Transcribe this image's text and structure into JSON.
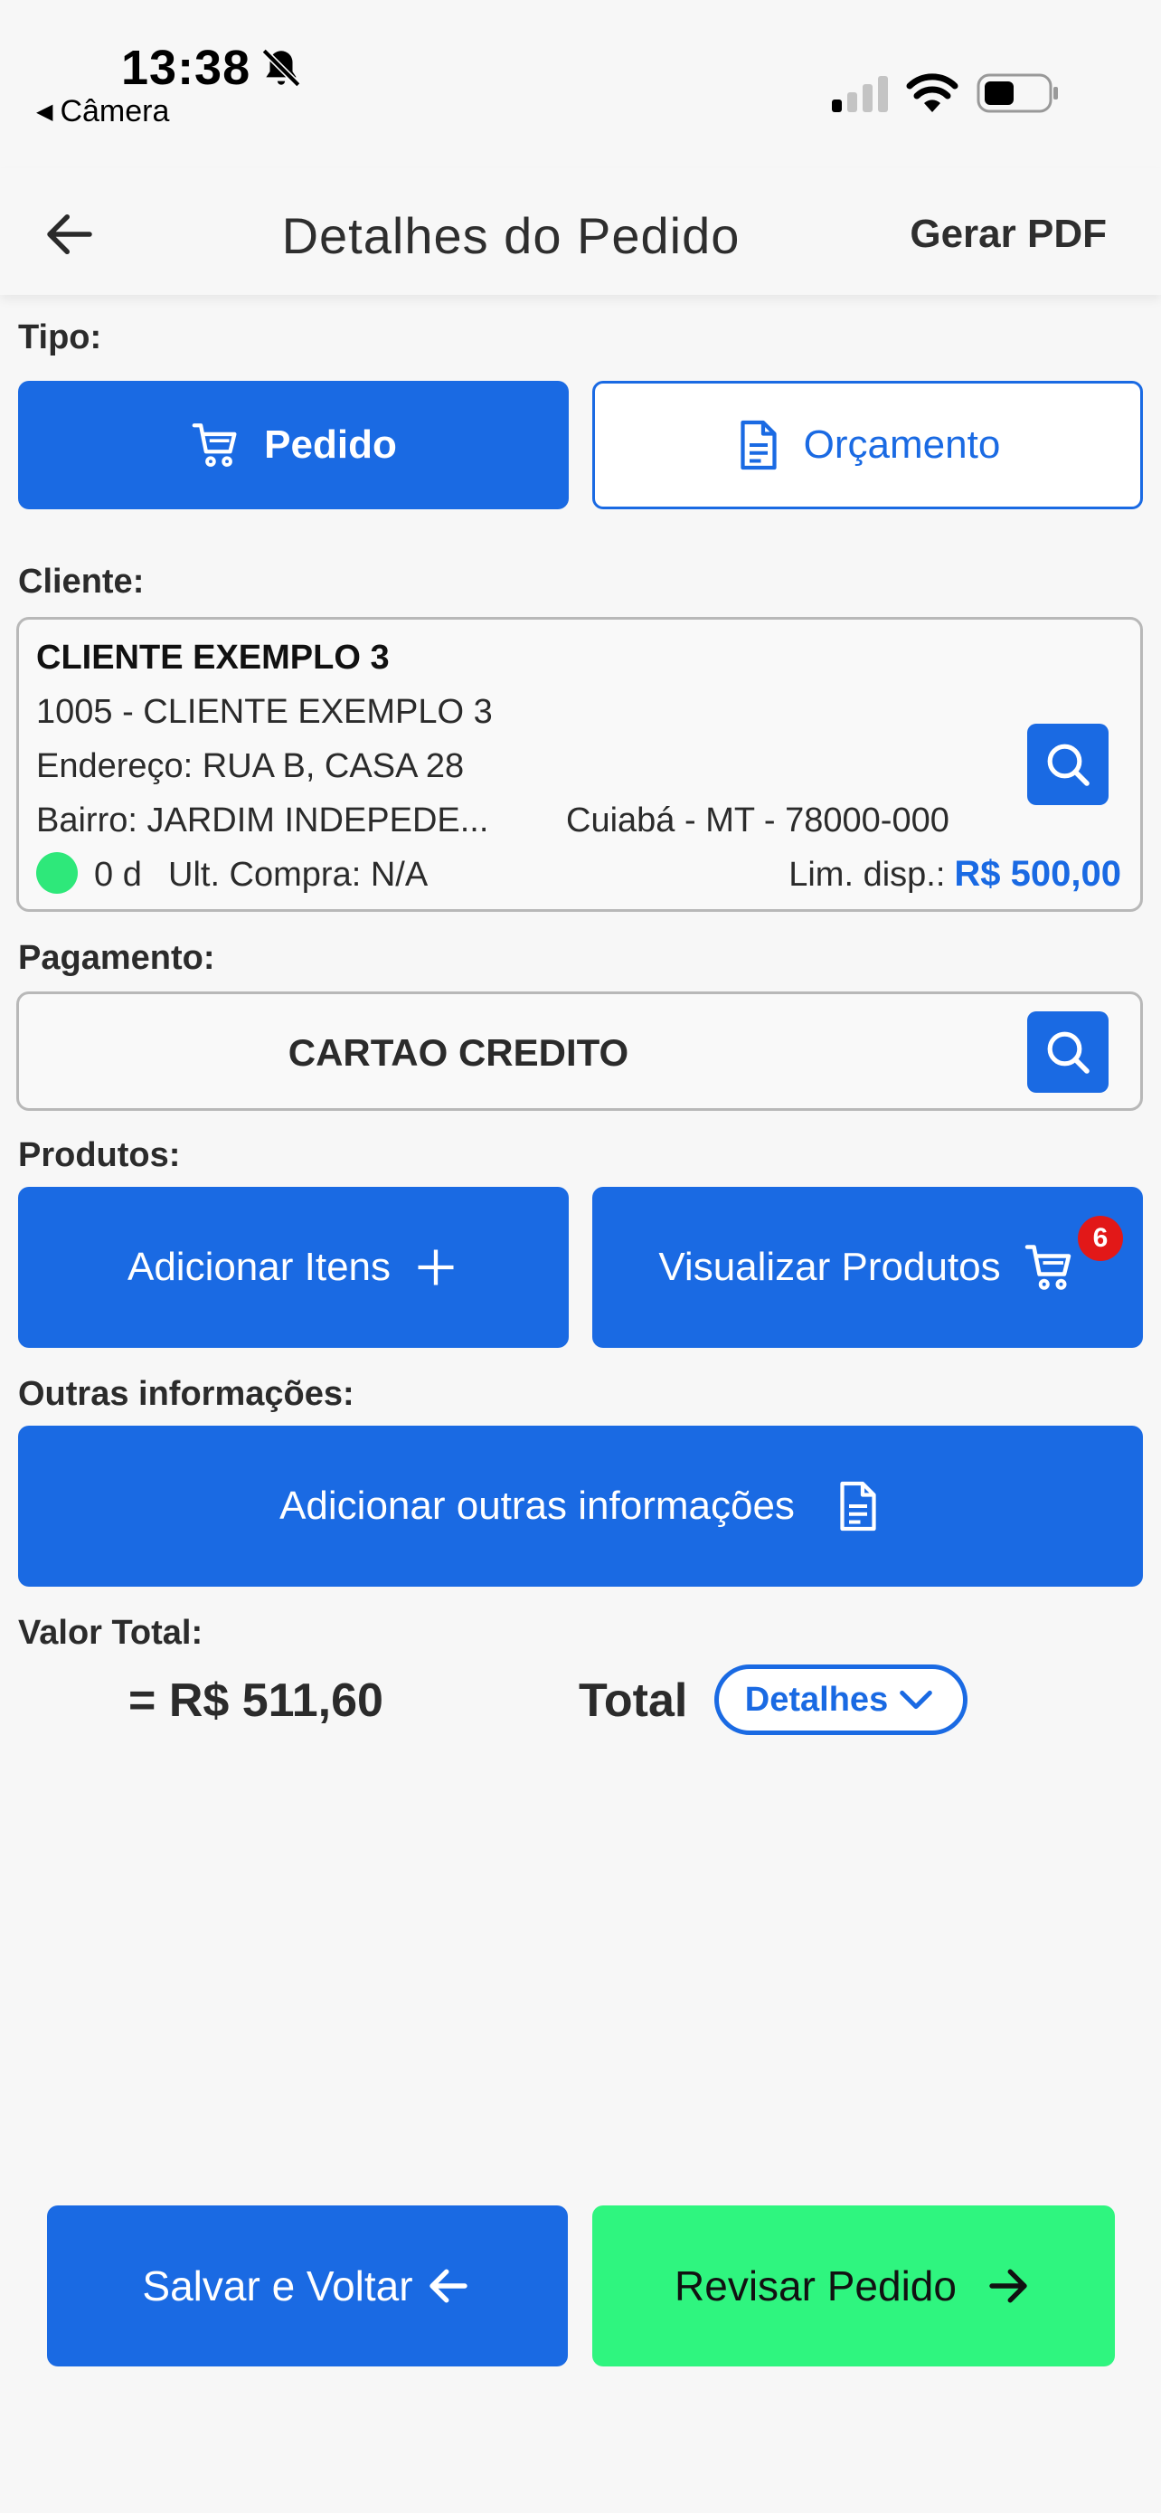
{
  "status_bar": {
    "time": "13:38",
    "back_app": "Câmera"
  },
  "header": {
    "title": "Detalhes do Pedido",
    "pdf_button": "Gerar PDF"
  },
  "tipo": {
    "label": "Tipo:",
    "pedido": "Pedido",
    "orcamento": "Orçamento"
  },
  "cliente": {
    "label": "Cliente:",
    "name": "CLIENTE EXEMPLO 3",
    "code_line": "1005 - CLIENTE EXEMPLO 3",
    "endereco": "Endereço: RUA B, CASA 28",
    "bairro": "Bairro: JARDIM INDEPEDE...",
    "cidade": "Cuiabá - MT - 78000-000",
    "dias": "0 d",
    "ult_compra": "Ult. Compra: N/A",
    "lim_label": "Lim. disp.:",
    "lim_value": "R$ 500,00",
    "status_color": "#2ee87a"
  },
  "pagamento": {
    "label": "Pagamento:",
    "value": "CARTAO CREDITO"
  },
  "produtos": {
    "label": "Produtos:",
    "add_items": "Adicionar Itens",
    "view_products": "Visualizar Produtos",
    "cart_count": "6"
  },
  "outras": {
    "label": "Outras informações:",
    "button": "Adicionar outras informações"
  },
  "total": {
    "label": "Valor Total:",
    "value": "= R$ 511,60",
    "total_word": "Total",
    "details_button": "Detalhes"
  },
  "footer": {
    "save_back": "Salvar e Voltar",
    "review": "Revisar Pedido"
  },
  "colors": {
    "primary": "#1a6ae3",
    "success": "#2ff57f",
    "badge": "#e21818"
  }
}
